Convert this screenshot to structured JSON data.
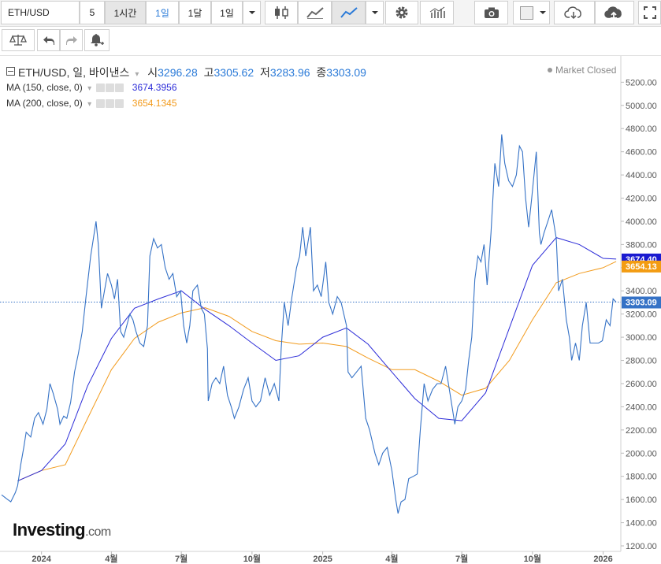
{
  "toolbar": {
    "symbol": "ETH/USD",
    "interval_input": "5",
    "intervals": [
      "1시간",
      "1일",
      "1달",
      "1일"
    ],
    "icons": [
      "candle-icon",
      "mountain-icon",
      "line-icon",
      "gear-icon",
      "bars-icon",
      "camera-icon",
      "color-box-icon",
      "cloud-download-icon",
      "cloud-upload-icon",
      "fullscreen-icon"
    ]
  },
  "toolbar2": {
    "icons": [
      "scale-icon",
      "undo-icon",
      "redo-icon",
      "alert-bell-icon"
    ]
  },
  "legend": {
    "title": "ETH/USD, 일, 바이낸스",
    "open_label": "시",
    "open": "3296.28",
    "high_label": "고",
    "high": "3305.62",
    "low_label": "저",
    "low": "3283.96",
    "close_label": "종",
    "close": "3303.09",
    "status": "Market Closed",
    "ma150_label": "MA (150, close, 0)",
    "ma150_value": "3674.3956",
    "ma200_label": "MA (200, close, 0)",
    "ma200_value": "3654.1345"
  },
  "brand": {
    "name": "Investing",
    "suffix": ".com"
  },
  "colors": {
    "price": "#3572c6",
    "ma150": "#2c2cd8",
    "ma200": "#f29b1d",
    "price_tag": "#3572c6",
    "ma150_tag": "#1a1ad0",
    "ma200_tag": "#f39c12"
  },
  "chart_data": {
    "type": "line",
    "xlabels": [
      "2024",
      "4월",
      "7월",
      "10월",
      "2025",
      "4월",
      "7월",
      "10월",
      "2026"
    ],
    "ylim": [
      1200,
      5300
    ],
    "yticks": [
      1200,
      1400,
      1600,
      1800,
      2000,
      2200,
      2400,
      2600,
      2800,
      3000,
      3200,
      3400,
      3600,
      3800,
      4000,
      4200,
      4400,
      4600,
      4800,
      5000,
      5200
    ],
    "yticklabels": [
      "1200.00",
      "1400.00",
      "1600.00",
      "1800.00",
      "2000.00",
      "2200.00",
      "2400.00",
      "2600.00",
      "2800.00",
      "3000.00",
      "3200.00",
      "3400.00",
      "3600.00",
      "3800.00",
      "4000.00",
      "4200.00",
      "4400.00",
      "4600.00",
      "4800.00",
      "5000.00",
      "5200.00"
    ],
    "last_price": 3303.09,
    "last_price_label": "3303.09",
    "ma150_last_label": "3674.40",
    "ma200_last_label": "3654.13",
    "series": [
      {
        "name": "ETH/USD",
        "points": [
          [
            "2023-11-10",
            1640
          ],
          [
            "2023-11-16",
            1610
          ],
          [
            "2023-11-22",
            1580
          ],
          [
            "2023-11-28",
            1660
          ],
          [
            "2023-12-01",
            1720
          ],
          [
            "2023-12-05",
            1900
          ],
          [
            "2023-12-09",
            2050
          ],
          [
            "2023-12-12",
            2180
          ],
          [
            "2023-12-18",
            2140
          ],
          [
            "2023-12-23",
            2300
          ],
          [
            "2023-12-28",
            2350
          ],
          [
            "2024-01-03",
            2250
          ],
          [
            "2024-01-08",
            2380
          ],
          [
            "2024-01-12",
            2600
          ],
          [
            "2024-01-16",
            2520
          ],
          [
            "2024-01-22",
            2380
          ],
          [
            "2024-01-25",
            2250
          ],
          [
            "2024-01-30",
            2320
          ],
          [
            "2024-02-03",
            2300
          ],
          [
            "2024-02-08",
            2440
          ],
          [
            "2024-02-13",
            2700
          ],
          [
            "2024-02-18",
            2860
          ],
          [
            "2024-02-23",
            3050
          ],
          [
            "2024-02-28",
            3350
          ],
          [
            "2024-03-05",
            3700
          ],
          [
            "2024-03-12",
            4000
          ],
          [
            "2024-03-15",
            3800
          ],
          [
            "2024-03-19",
            3250
          ],
          [
            "2024-03-23",
            3400
          ],
          [
            "2024-03-27",
            3550
          ],
          [
            "2024-04-01",
            3450
          ],
          [
            "2024-04-05",
            3330
          ],
          [
            "2024-04-09",
            3500
          ],
          [
            "2024-04-13",
            3050
          ],
          [
            "2024-04-17",
            3000
          ],
          [
            "2024-04-21",
            3100
          ],
          [
            "2024-04-25",
            3200
          ],
          [
            "2024-04-29",
            3150
          ],
          [
            "2024-05-03",
            3050
          ],
          [
            "2024-05-08",
            2950
          ],
          [
            "2024-05-13",
            2920
          ],
          [
            "2024-05-18",
            3100
          ],
          [
            "2024-05-21",
            3700
          ],
          [
            "2024-05-26",
            3850
          ],
          [
            "2024-05-31",
            3770
          ],
          [
            "2024-06-05",
            3800
          ],
          [
            "2024-06-10",
            3600
          ],
          [
            "2024-06-15",
            3500
          ],
          [
            "2024-06-20",
            3550
          ],
          [
            "2024-06-25",
            3350
          ],
          [
            "2024-06-30",
            3400
          ],
          [
            "2024-07-04",
            3100
          ],
          [
            "2024-07-08",
            2950
          ],
          [
            "2024-07-12",
            3100
          ],
          [
            "2024-07-16",
            3400
          ],
          [
            "2024-07-22",
            3450
          ],
          [
            "2024-07-27",
            3250
          ],
          [
            "2024-07-31",
            3200
          ],
          [
            "2024-08-04",
            2900
          ],
          [
            "2024-08-05",
            2450
          ],
          [
            "2024-08-10",
            2600
          ],
          [
            "2024-08-15",
            2650
          ],
          [
            "2024-08-20",
            2600
          ],
          [
            "2024-08-25",
            2750
          ],
          [
            "2024-08-30",
            2500
          ],
          [
            "2024-09-04",
            2400
          ],
          [
            "2024-09-08",
            2300
          ],
          [
            "2024-09-14",
            2400
          ],
          [
            "2024-09-20",
            2550
          ],
          [
            "2024-09-26",
            2650
          ],
          [
            "2024-10-01",
            2450
          ],
          [
            "2024-10-06",
            2400
          ],
          [
            "2024-10-12",
            2450
          ],
          [
            "2024-10-18",
            2650
          ],
          [
            "2024-10-24",
            2500
          ],
          [
            "2024-10-30",
            2600
          ],
          [
            "2024-11-05",
            2450
          ],
          [
            "2024-11-08",
            2900
          ],
          [
            "2024-11-12",
            3300
          ],
          [
            "2024-11-17",
            3100
          ],
          [
            "2024-11-22",
            3350
          ],
          [
            "2024-11-28",
            3600
          ],
          [
            "2024-12-02",
            3700
          ],
          [
            "2024-12-06",
            3950
          ],
          [
            "2024-12-10",
            3700
          ],
          [
            "2024-12-16",
            3950
          ],
          [
            "2024-12-20",
            3400
          ],
          [
            "2024-12-25",
            3450
          ],
          [
            "2024-12-30",
            3350
          ],
          [
            "2025-01-05",
            3650
          ],
          [
            "2025-01-09",
            3300
          ],
          [
            "2025-01-14",
            3200
          ],
          [
            "2025-01-20",
            3350
          ],
          [
            "2025-01-25",
            3300
          ],
          [
            "2025-02-01",
            3100
          ],
          [
            "2025-02-03",
            2700
          ],
          [
            "2025-02-08",
            2650
          ],
          [
            "2025-02-14",
            2700
          ],
          [
            "2025-02-20",
            2750
          ],
          [
            "2025-02-26",
            2300
          ],
          [
            "2025-03-03",
            2200
          ],
          [
            "2025-03-10",
            2000
          ],
          [
            "2025-03-15",
            1900
          ],
          [
            "2025-03-20",
            2000
          ],
          [
            "2025-03-26",
            2050
          ],
          [
            "2025-04-01",
            1850
          ],
          [
            "2025-04-06",
            1600
          ],
          [
            "2025-04-09",
            1480
          ],
          [
            "2025-04-13",
            1580
          ],
          [
            "2025-04-18",
            1600
          ],
          [
            "2025-04-23",
            1780
          ],
          [
            "2025-04-29",
            1800
          ],
          [
            "2025-05-04",
            1820
          ],
          [
            "2025-05-08",
            2200
          ],
          [
            "2025-05-13",
            2600
          ],
          [
            "2025-05-18",
            2450
          ],
          [
            "2025-05-24",
            2550
          ],
          [
            "2025-05-30",
            2600
          ],
          [
            "2025-06-04",
            2600
          ],
          [
            "2025-06-10",
            2750
          ],
          [
            "2025-06-16",
            2500
          ],
          [
            "2025-06-22",
            2250
          ],
          [
            "2025-06-26",
            2400
          ],
          [
            "2025-07-01",
            2450
          ],
          [
            "2025-07-06",
            2550
          ],
          [
            "2025-07-10",
            2800
          ],
          [
            "2025-07-14",
            3000
          ],
          [
            "2025-07-18",
            3500
          ],
          [
            "2025-07-22",
            3700
          ],
          [
            "2025-07-26",
            3650
          ],
          [
            "2025-07-30",
            3800
          ],
          [
            "2025-08-03",
            3450
          ],
          [
            "2025-08-08",
            3900
          ],
          [
            "2025-08-13",
            4500
          ],
          [
            "2025-08-18",
            4300
          ],
          [
            "2025-08-22",
            4750
          ],
          [
            "2025-08-26",
            4500
          ],
          [
            "2025-08-31",
            4350
          ],
          [
            "2025-09-05",
            4300
          ],
          [
            "2025-09-10",
            4400
          ],
          [
            "2025-09-14",
            4650
          ],
          [
            "2025-09-18",
            4600
          ],
          [
            "2025-09-22",
            4200
          ],
          [
            "2025-09-26",
            3950
          ],
          [
            "2025-09-30",
            4200
          ],
          [
            "2025-10-06",
            4600
          ],
          [
            "2025-10-10",
            3900
          ],
          [
            "2025-10-12",
            3800
          ],
          [
            "2025-10-16",
            3900
          ],
          [
            "2025-10-21",
            4000
          ],
          [
            "2025-10-26",
            4100
          ],
          [
            "2025-11-01",
            3850
          ],
          [
            "2025-11-04",
            3400
          ],
          [
            "2025-11-09",
            3500
          ],
          [
            "2025-11-14",
            3150
          ],
          [
            "2025-11-18",
            3000
          ],
          [
            "2025-11-21",
            2800
          ],
          [
            "2025-11-26",
            2950
          ],
          [
            "2025-12-01",
            2800
          ],
          [
            "2025-12-05",
            3100
          ],
          [
            "2025-12-10",
            3300
          ],
          [
            "2025-12-15",
            2950
          ],
          [
            "2025-12-20",
            2950
          ],
          [
            "2025-12-26",
            2950
          ],
          [
            "2025-12-31",
            2970
          ],
          [
            "2026-01-05",
            3150
          ],
          [
            "2026-01-10",
            3100
          ],
          [
            "2026-01-14",
            3330
          ],
          [
            "2026-01-18",
            3303
          ]
        ]
      },
      {
        "name": "MA (150, close, 0)",
        "points": [
          [
            "2023-12-01",
            1760
          ],
          [
            "2024-01-01",
            1850
          ],
          [
            "2024-02-01",
            2080
          ],
          [
            "2024-03-01",
            2580
          ],
          [
            "2024-04-01",
            2990
          ],
          [
            "2024-05-01",
            3250
          ],
          [
            "2024-06-01",
            3330
          ],
          [
            "2024-07-01",
            3400
          ],
          [
            "2024-08-01",
            3240
          ],
          [
            "2024-09-01",
            3100
          ],
          [
            "2024-10-01",
            2950
          ],
          [
            "2024-11-01",
            2800
          ],
          [
            "2024-12-01",
            2840
          ],
          [
            "2025-01-01",
            3000
          ],
          [
            "2025-02-01",
            3080
          ],
          [
            "2025-03-01",
            2940
          ],
          [
            "2025-04-01",
            2700
          ],
          [
            "2025-05-01",
            2470
          ],
          [
            "2025-06-01",
            2300
          ],
          [
            "2025-07-01",
            2280
          ],
          [
            "2025-08-01",
            2520
          ],
          [
            "2025-09-01",
            3080
          ],
          [
            "2025-10-01",
            3620
          ],
          [
            "2025-11-01",
            3860
          ],
          [
            "2025-12-01",
            3800
          ],
          [
            "2026-01-01",
            3680
          ],
          [
            "2026-01-18",
            3674
          ]
        ]
      },
      {
        "name": "MA (200, close, 0)",
        "points": [
          [
            "2023-12-01",
            1760
          ],
          [
            "2024-01-01",
            1850
          ],
          [
            "2024-02-01",
            1900
          ],
          [
            "2024-03-01",
            2300
          ],
          [
            "2024-04-01",
            2720
          ],
          [
            "2024-05-01",
            2990
          ],
          [
            "2024-06-01",
            3130
          ],
          [
            "2024-07-01",
            3210
          ],
          [
            "2024-08-01",
            3255
          ],
          [
            "2024-09-01",
            3180
          ],
          [
            "2024-10-01",
            3050
          ],
          [
            "2024-11-01",
            2970
          ],
          [
            "2024-12-01",
            2940
          ],
          [
            "2025-01-01",
            2950
          ],
          [
            "2025-02-01",
            2920
          ],
          [
            "2025-03-01",
            2820
          ],
          [
            "2025-04-01",
            2720
          ],
          [
            "2025-05-01",
            2720
          ],
          [
            "2025-06-01",
            2620
          ],
          [
            "2025-07-01",
            2500
          ],
          [
            "2025-08-01",
            2560
          ],
          [
            "2025-09-01",
            2800
          ],
          [
            "2025-10-01",
            3150
          ],
          [
            "2025-11-01",
            3470
          ],
          [
            "2025-12-01",
            3550
          ],
          [
            "2026-01-01",
            3600
          ],
          [
            "2026-01-18",
            3654
          ]
        ]
      }
    ]
  }
}
